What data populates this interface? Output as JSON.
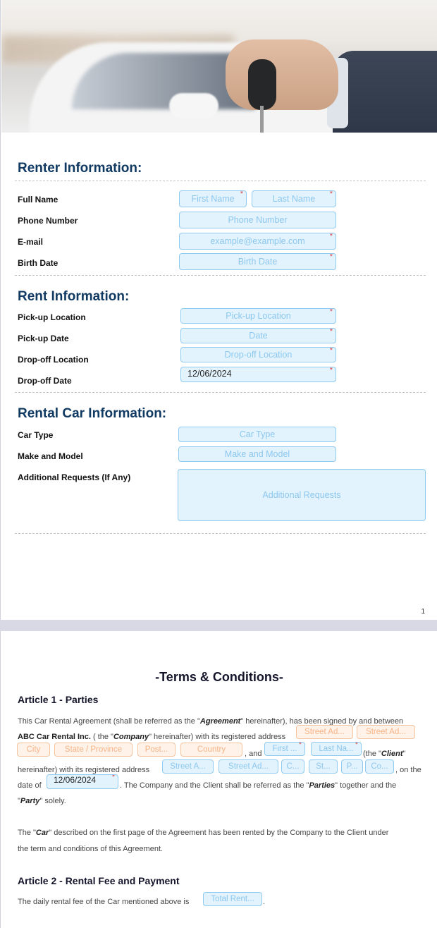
{
  "hero": {
    "description": "hand holding car key in front of white car"
  },
  "renter": {
    "title": "Renter Information:",
    "full_name_label": "Full Name",
    "first_name_placeholder": "First Name",
    "last_name_placeholder": "Last Name",
    "phone_label": "Phone Number",
    "phone_placeholder": "Phone Number",
    "email_label": "E-mail",
    "email_placeholder": "example@example.com",
    "birth_label": "Birth Date",
    "birth_placeholder": "Birth Date"
  },
  "rent": {
    "title": "Rent Information:",
    "pickup_location_label": "Pick-up Location",
    "pickup_location_placeholder": "Pick-up Location",
    "pickup_date_label": "Pick-up Date",
    "pickup_date_placeholder": "Date",
    "dropoff_location_label": "Drop-off Location",
    "dropoff_location_placeholder": "Drop-off Location",
    "dropoff_date_label": "Drop-off Date",
    "dropoff_date_value": "12/06/2024"
  },
  "car": {
    "title": "Rental Car Information:",
    "type_label": "Car Type",
    "type_placeholder": "Car Type",
    "make_label": "Make and Model",
    "make_placeholder": "Make and Model",
    "requests_label": "Additional Requests (If Any)",
    "requests_placeholder": "Additional Requests"
  },
  "required_mark": "*",
  "page1_number": "1",
  "terms": {
    "title": "-Terms & Conditions-",
    "article1": {
      "heading": "Article 1 - Parties",
      "line1_a": "This Car Rental Agreement (shall be referred as the \"",
      "line1_b": "Agreement",
      "line1_c": "\" hereinafter), has been signed by and between",
      "company_name": "ABC Car Rental Inc.",
      "line2_a": " ( the \"",
      "line2_b": "Company",
      "line2_c": "\" hereinafter) with its registered address",
      "company_street1": "Street Ad...",
      "company_street2": "Street Ad...",
      "company_city": "City",
      "company_state": "State / Province",
      "company_postal": "Post...",
      "company_country": "Country",
      "and_text": ", and",
      "client_first": "First ...",
      "client_last": "Last Na...",
      "client_a": "(the \"",
      "client_b": "Client",
      "client_c": "\"",
      "line4_a": "hereinafter) with its registered address",
      "client_street1": "Street A...",
      "client_street2": "Street Ad...",
      "client_city": "C...",
      "client_state": "St...",
      "client_postal": "P...",
      "client_country": "Co...",
      "on_the": ", on the",
      "date_of": "date of",
      "date_value": "12/06/2024",
      "line5_a": ". The Company and the Client shall be referred as the \"",
      "line5_b": "Parties",
      "line5_c": "\" together and the",
      "line6_a": "\"",
      "line6_b": "Party",
      "line6_c": "\" solely.",
      "car_a": "The \"",
      "car_b": "Car",
      "car_c": "\" described on the first page of the Agreement has been rented by the Company to the Client under",
      "car_line2": "the term and conditions of this Agreement."
    },
    "article2": {
      "heading": "Article 2 - Rental Fee and Payment",
      "fee_text": "The daily rental fee of the Car mentioned above is",
      "fee_placeholder": "Total Rent...",
      "fee_end": "."
    }
  }
}
